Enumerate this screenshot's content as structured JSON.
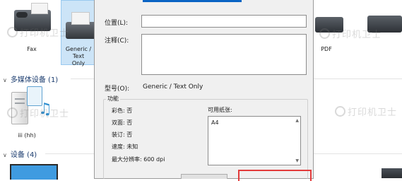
{
  "devices_top": [
    {
      "label": "Fax"
    },
    {
      "label": "Generic /\nText\nOnly"
    }
  ],
  "right_partial_label": "PDF",
  "sections": {
    "multimedia": {
      "title": "多媒体设备 (1)"
    },
    "devices": {
      "title": "设备 (4)"
    }
  },
  "media_device": {
    "label": "iii (hh)"
  },
  "watermark": {
    "text": "打印机卫士"
  },
  "dialog": {
    "location_label": "位置(L):",
    "location_value": "",
    "comment_label": "注释(C):",
    "comment_value": "",
    "model_label": "型号(O):",
    "model_value": "Generic / Text Only",
    "features": {
      "title": "功能",
      "color": "彩色: 否",
      "duplex": "双面: 否",
      "staple": "装订: 否",
      "speed": "速度: 未知",
      "max_resolution": "最大分辨率: 600 dpi",
      "paper_label": "可用纸张:",
      "paper_items": [
        "A4"
      ]
    }
  },
  "colors": {
    "accent": "#0a64c4",
    "highlight_box": "#e23b3b",
    "section_title": "#1a3b6e"
  }
}
